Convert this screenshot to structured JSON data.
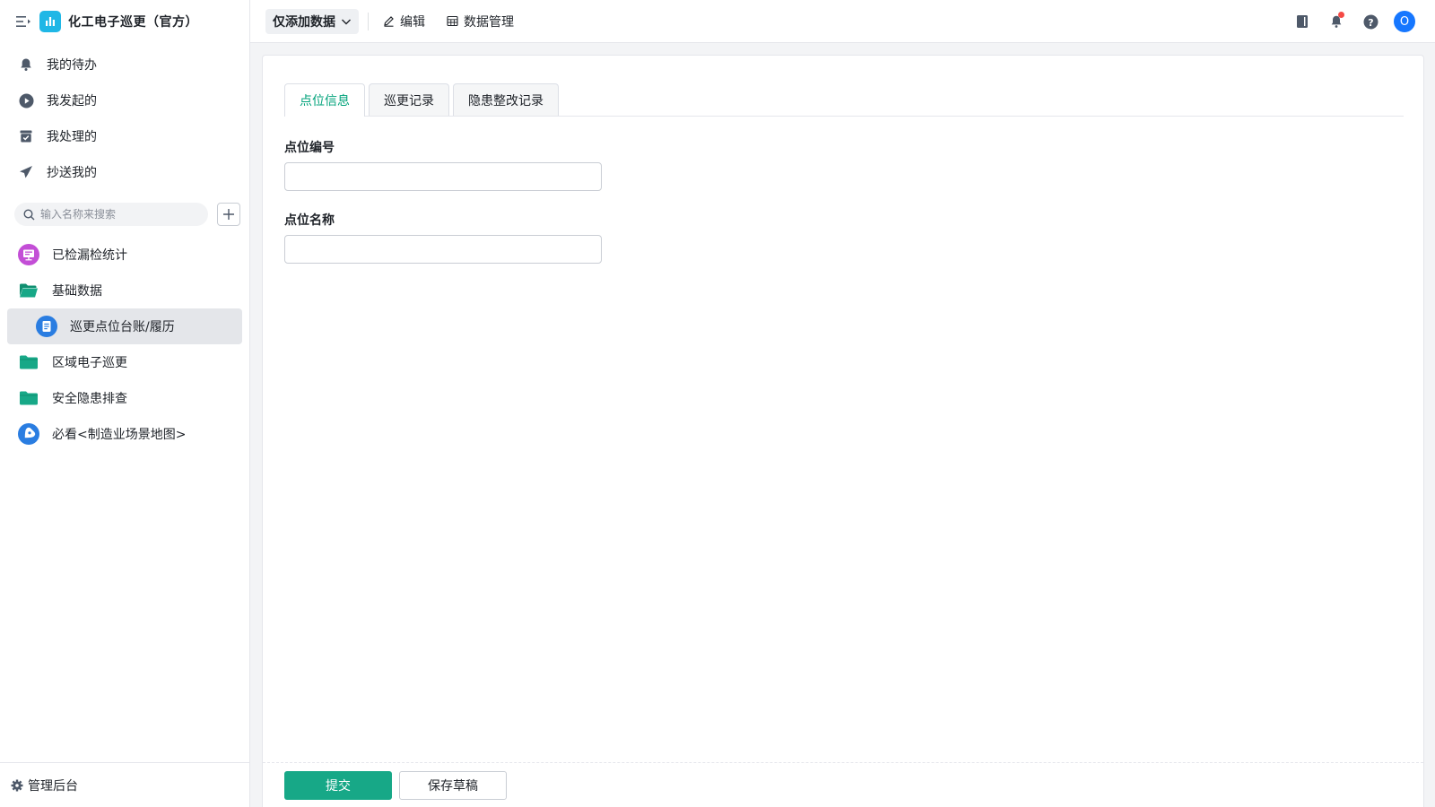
{
  "app": {
    "title": "化工电子巡更（官方）",
    "logo_icon": "bar-chart-icon",
    "logo_color": "#1fb7e6"
  },
  "nav": [
    {
      "label": "我的待办",
      "icon": "bell-icon"
    },
    {
      "label": "我发起的",
      "icon": "play-circle-icon"
    },
    {
      "label": "我处理的",
      "icon": "inbox-check-icon"
    },
    {
      "label": "抄送我的",
      "icon": "send-icon"
    }
  ],
  "search": {
    "placeholder": "输入名称来搜索",
    "value": ""
  },
  "tree": [
    {
      "label": "已检漏检统计",
      "icon": "dashboard-icon",
      "color": "#c34ed6"
    },
    {
      "label": "基础数据",
      "icon": "folder-open-icon",
      "color": "#17a887"
    },
    {
      "label": "巡更点位台账/履历",
      "icon": "form-icon",
      "color": "#2a7de1",
      "selected": true
    },
    {
      "label": "区域电子巡更",
      "icon": "folder-icon",
      "color": "#17a887"
    },
    {
      "label": "安全隐患排查",
      "icon": "folder-icon",
      "color": "#17a887"
    },
    {
      "label": "必看<制造业场景地图>",
      "icon": "map-pin-icon",
      "color": "#2a7de1"
    }
  ],
  "admin": {
    "label": "管理后台",
    "icon": "gear-icon"
  },
  "topbar": {
    "view_label": "仅添加数据",
    "edit_label": "编辑",
    "data_manage_label": "数据管理",
    "avatar_text": "O",
    "right_icons": [
      "notebook-icon",
      "notification-icon",
      "help-icon"
    ]
  },
  "tabs": [
    {
      "label": "点位信息",
      "active": true
    },
    {
      "label": "巡更记录",
      "active": false
    },
    {
      "label": "隐患整改记录",
      "active": false
    }
  ],
  "form": {
    "fields": [
      {
        "label": "点位编号",
        "value": ""
      },
      {
        "label": "点位名称",
        "value": ""
      }
    ]
  },
  "footer": {
    "submit_label": "提交",
    "draft_label": "保存草稿"
  },
  "colors": {
    "accent": "#17a887",
    "active_tab": "#00a27a",
    "selected_bg": "#e4e6ea",
    "avatar": "#1677ff",
    "badge": "#f54a45"
  }
}
